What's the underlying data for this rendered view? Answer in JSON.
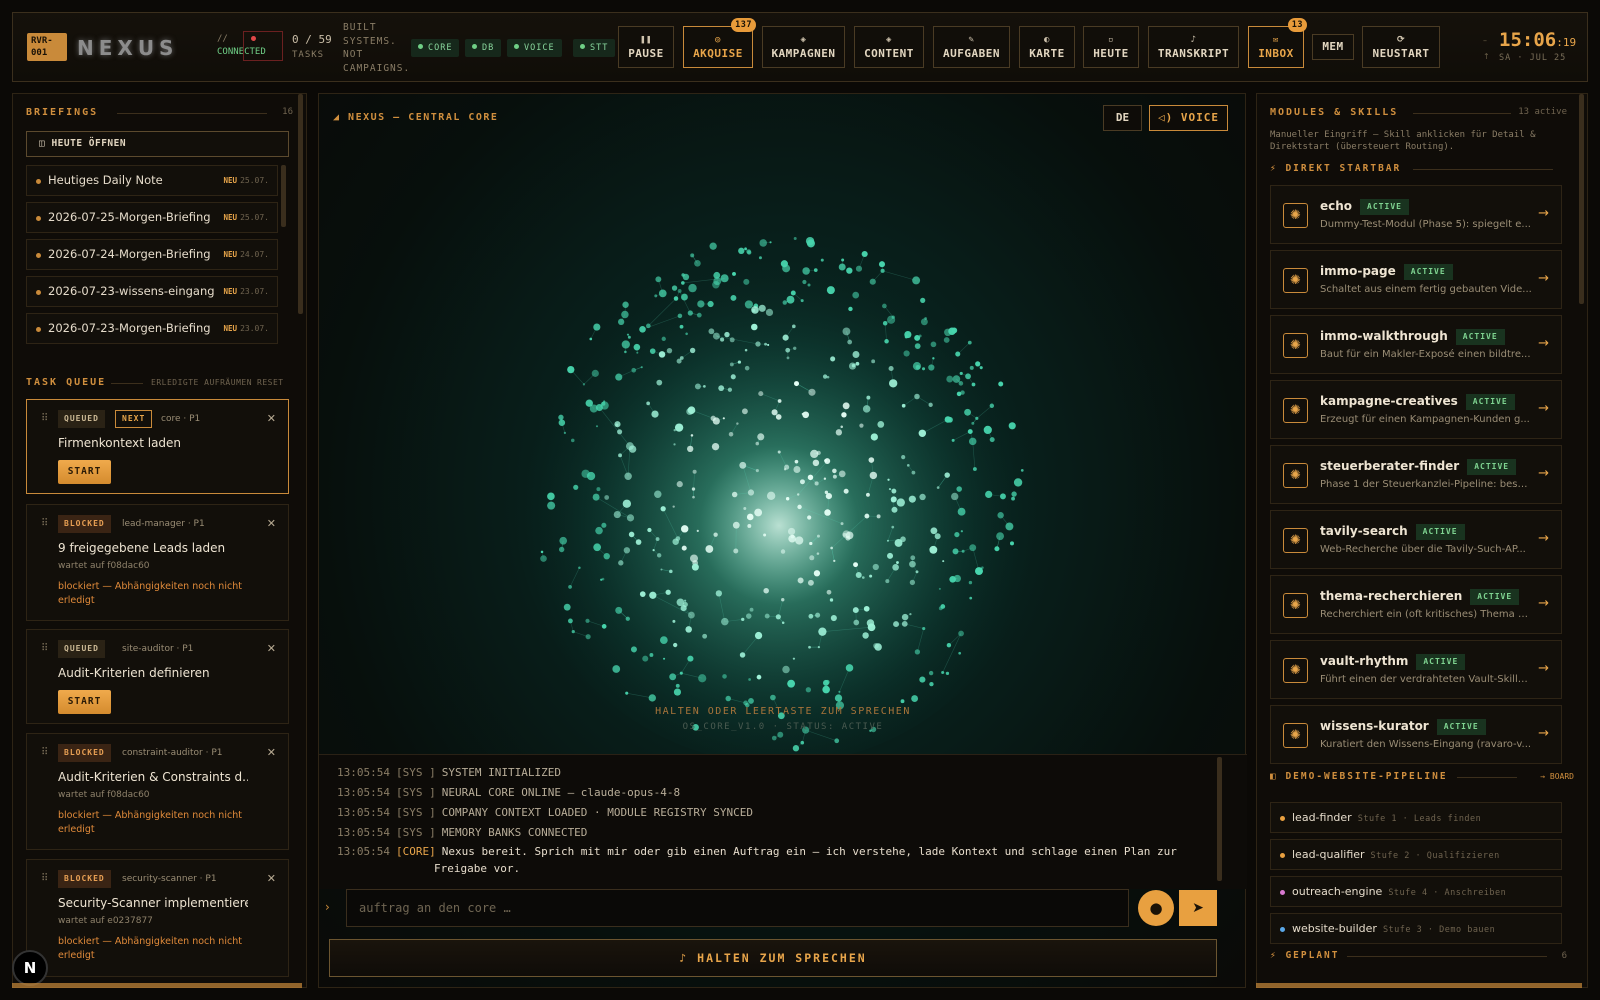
{
  "header": {
    "brand_id": "RVR-001",
    "logo": "NEXUS",
    "conn_prefix": "//",
    "conn_status": "CONNECTED",
    "tasks_count": "0 / 59",
    "tasks_label": "TASKS",
    "slogan_lines": [
      "BUILT",
      "SYSTEMS.",
      "NOT",
      "CAMPAIGNS."
    ],
    "pills": [
      "CORE",
      "DB",
      "VOICE",
      "STT"
    ],
    "nav": [
      {
        "label": "PAUSE",
        "icon": "pause-icon"
      },
      {
        "label": "AKQUISE",
        "icon": "target-icon",
        "badge": "137"
      },
      {
        "label": "KAMPAGNEN",
        "icon": "diamond-icon"
      },
      {
        "label": "CONTENT",
        "icon": "diamond-icon"
      },
      {
        "label": "AUFGABEN",
        "icon": "pencil-icon"
      },
      {
        "label": "KARTE",
        "icon": "compass-icon"
      },
      {
        "label": "HEUTE",
        "icon": "calendar-icon"
      },
      {
        "label": "TRANSKRIPT",
        "icon": "microphone-icon"
      },
      {
        "label": "INBOX",
        "icon": "mail-icon",
        "badge": "13"
      },
      {
        "label": "MEM",
        "icon": ""
      },
      {
        "label": "NEUSTART",
        "icon": "refresh-icon"
      }
    ],
    "clock_hm": "15:06",
    "clock_s": ":19",
    "date": "SA · JUL 25"
  },
  "briefings": {
    "title": "BRIEFINGS",
    "count": "16",
    "open_button": "HEUTE ÖFFNEN",
    "items": [
      {
        "label": "Heutiges Daily Note",
        "badge": "NEU",
        "date": "25.07."
      },
      {
        "label": "2026-07-25-Morgen-Briefing",
        "badge": "NEU",
        "date": "25.07."
      },
      {
        "label": "2026-07-24-Morgen-Briefing",
        "badge": "NEU",
        "date": "24.07."
      },
      {
        "label": "2026-07-23-wissens-eingang",
        "badge": "NEU",
        "date": "23.07."
      },
      {
        "label": "2026-07-23-Morgen-Briefing",
        "badge": "NEU",
        "date": "23.07."
      }
    ]
  },
  "queue": {
    "title": "TASK QUEUE",
    "clear": "ERLEDIGTE AUFRÄUMEN",
    "reset": "RESET",
    "start_label": "START",
    "tasks": [
      {
        "status": "QUEUED",
        "next": "NEXT",
        "meta": "core · P1",
        "title": "Firmenkontext laden"
      },
      {
        "status": "BLOCKED",
        "meta": "lead-manager · P1",
        "title": "9 freigegebene Leads laden",
        "wait": "wartet auf f08dac60",
        "blocked": "blockiert — Abhängigkeiten noch nicht erledigt"
      },
      {
        "status": "QUEUED",
        "meta": "site-auditor · P1",
        "title": "Audit-Kriterien definieren"
      },
      {
        "status": "BLOCKED",
        "meta": "constraint-auditor · P1",
        "title": "Audit-Kriterien & Constraints d...",
        "wait": "wartet auf f08dac60",
        "blocked": "blockiert — Abhängigkeiten noch nicht erledigt"
      },
      {
        "status": "BLOCKED",
        "meta": "security-scanner · P1",
        "title": "Security-Scanner implementieren",
        "wait": "wartet auf e0237877",
        "blocked": "blockiert — Abhängigkeiten noch nicht erledigt"
      }
    ]
  },
  "core": {
    "title": "NEXUS — CENTRAL CORE",
    "lang_button": "DE",
    "voice_button": "VOICE",
    "hint": "HALTEN ODER LEERTASTE ZUM SPRECHEN",
    "status": "OS_CORE_V1.0 · STATUS: ACTIVE",
    "log": [
      {
        "time": "13:05:54",
        "tag": "[SYS ]",
        "text": "SYSTEM INITIALIZED"
      },
      {
        "time": "13:05:54",
        "tag": "[SYS ]",
        "text": "NEURAL CORE ONLINE — claude-opus-4-8"
      },
      {
        "time": "13:05:54",
        "tag": "[SYS ]",
        "text": "COMPANY CONTEXT LOADED · MODULE REGISTRY SYNCED"
      },
      {
        "time": "13:05:54",
        "tag": "[SYS ]",
        "text": "MEMORY BANKS CONNECTED"
      },
      {
        "time": "13:05:54",
        "tag": "[CORE]",
        "text": "Nexus bereit. Sprich mit mir oder gib einen Auftrag ein — ich verstehe, lade Kontext und schlage einen Plan zur",
        "text2": "Freigabe vor."
      }
    ],
    "input_placeholder": "auftrag an den core …",
    "hold_button": "HALTEN ZUM SPRECHEN"
  },
  "modules": {
    "title": "MODULES & SKILLS",
    "count": "13 active",
    "subtitle": "Manueller Eingriff — Skill anklicken für Detail & Direktstart (übersteuert Routing).",
    "direct_title": "DIREKT STARTBAR",
    "active_label": "ACTIVE",
    "items": [
      {
        "name": "echo",
        "desc": "Dummy-Test-Modul (Phase 5): spiegelt e..."
      },
      {
        "name": "immo-page",
        "desc": "Schaltet aus einem fertig gebauten Vide..."
      },
      {
        "name": "immo-walkthrough",
        "desc": "Baut für ein Makler-Exposé einen bildtre..."
      },
      {
        "name": "kampagne-creatives",
        "desc": "Erzeugt für einen Kampagnen-Kunden g..."
      },
      {
        "name": "steuerberater-finder",
        "desc": "Phase 1 der Steuerkanzlei-Pipeline: besc..."
      },
      {
        "name": "tavily-search",
        "desc": "Web-Recherche über die Tavily-Such-AP..."
      },
      {
        "name": "thema-recherchieren",
        "desc": "Recherchiert ein (oft kritisches) Thema u..."
      },
      {
        "name": "vault-rhythm",
        "desc": "Führt einen der verdrahteten Vault-Skills..."
      },
      {
        "name": "wissens-kurator",
        "desc": "Kuratiert den Wissens-Eingang (ravaro-v..."
      }
    ],
    "pipeline_title": "DEMO-WEBSITE-PIPELINE",
    "pipeline_link": "→ BOARD",
    "pipeline": [
      {
        "name": "lead-finder",
        "stage": "Stufe 1 · Leads finden",
        "color": "#e8a040"
      },
      {
        "name": "lead-qualifier",
        "stage": "Stufe 2 · Qualifizieren",
        "color": "#e8a040"
      },
      {
        "name": "outreach-engine",
        "stage": "Stufe 4 · Anschreiben",
        "color": "#d97ad0"
      },
      {
        "name": "website-builder",
        "stage": "Stufe 3 · Demo bauen",
        "color": "#5aa8e8"
      }
    ],
    "planned_title": "GEPLANT",
    "planned_count": "6"
  },
  "colors": {
    "accent": "#e8a54a",
    "active": "#7fd491",
    "bg": "#0b0906"
  }
}
